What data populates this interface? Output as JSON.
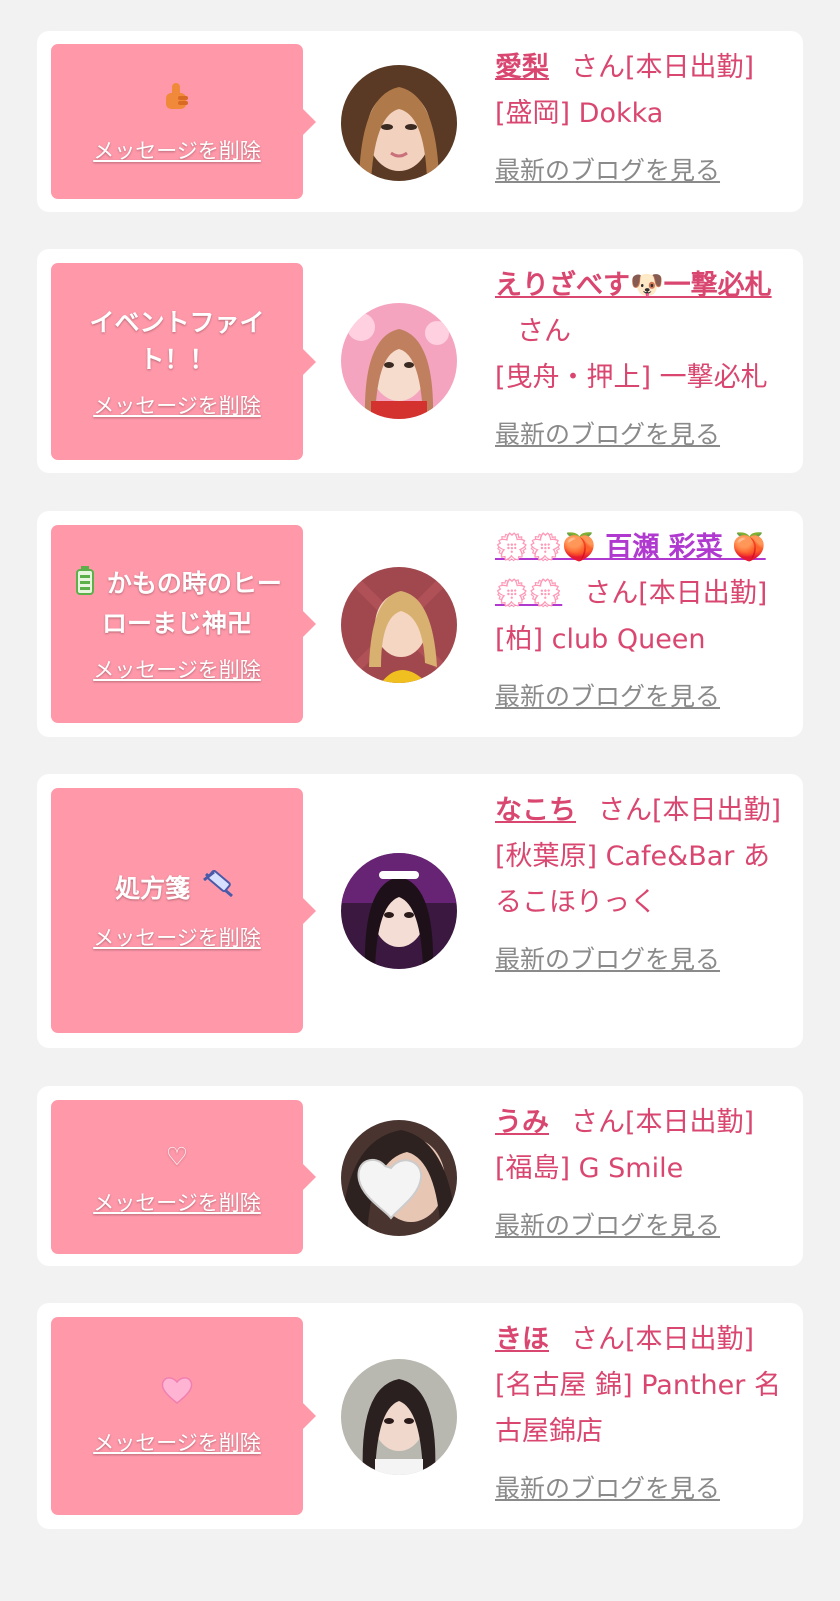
{
  "delete_label": "メッセージを削除",
  "blog_label": "最新のブログを見る",
  "suffix_label": "さん",
  "colors": {
    "page_bg": "#f2f2f2",
    "card_bg": "#ffffff",
    "bubble_bg": "#ff99aa",
    "name_pink": "#d94770",
    "name_purple": "#b03ad0",
    "blog_gray": "#8a8a8a"
  },
  "items": [
    {
      "message": "",
      "message_icon": "thumbs-up-icon",
      "name": "愛梨",
      "status": "[本日出勤]",
      "shop": "[盛岡] Dokka"
    },
    {
      "message": "イベントファイト！！",
      "message_icon": "",
      "name": "えりざべす🐶一撃必札",
      "status": "",
      "shop": "[曳舟・押上] 一撃必札"
    },
    {
      "message": "かもの時のヒーローまじ神卍",
      "message_icon": "battery-icon",
      "name": "💮💮🍑 百瀬 彩菜 🍑💮💮",
      "status": "[本日出勤]",
      "shop": "[柏] club Queen"
    },
    {
      "message": "処方箋",
      "message_icon": "syringe-icon",
      "name": "なこち",
      "status": "[本日出勤]",
      "shop": "[秋葉原] Cafe&Bar あるこほりっく"
    },
    {
      "message": "♡",
      "message_icon": "",
      "name": "うみ",
      "status": "[本日出勤]",
      "shop": "[福島] G Smile"
    },
    {
      "message": "",
      "message_icon": "pink-heart-icon",
      "name": "きほ",
      "status": "[本日出勤]",
      "shop": "[名古屋 錦] Panther 名古屋錦店"
    }
  ]
}
